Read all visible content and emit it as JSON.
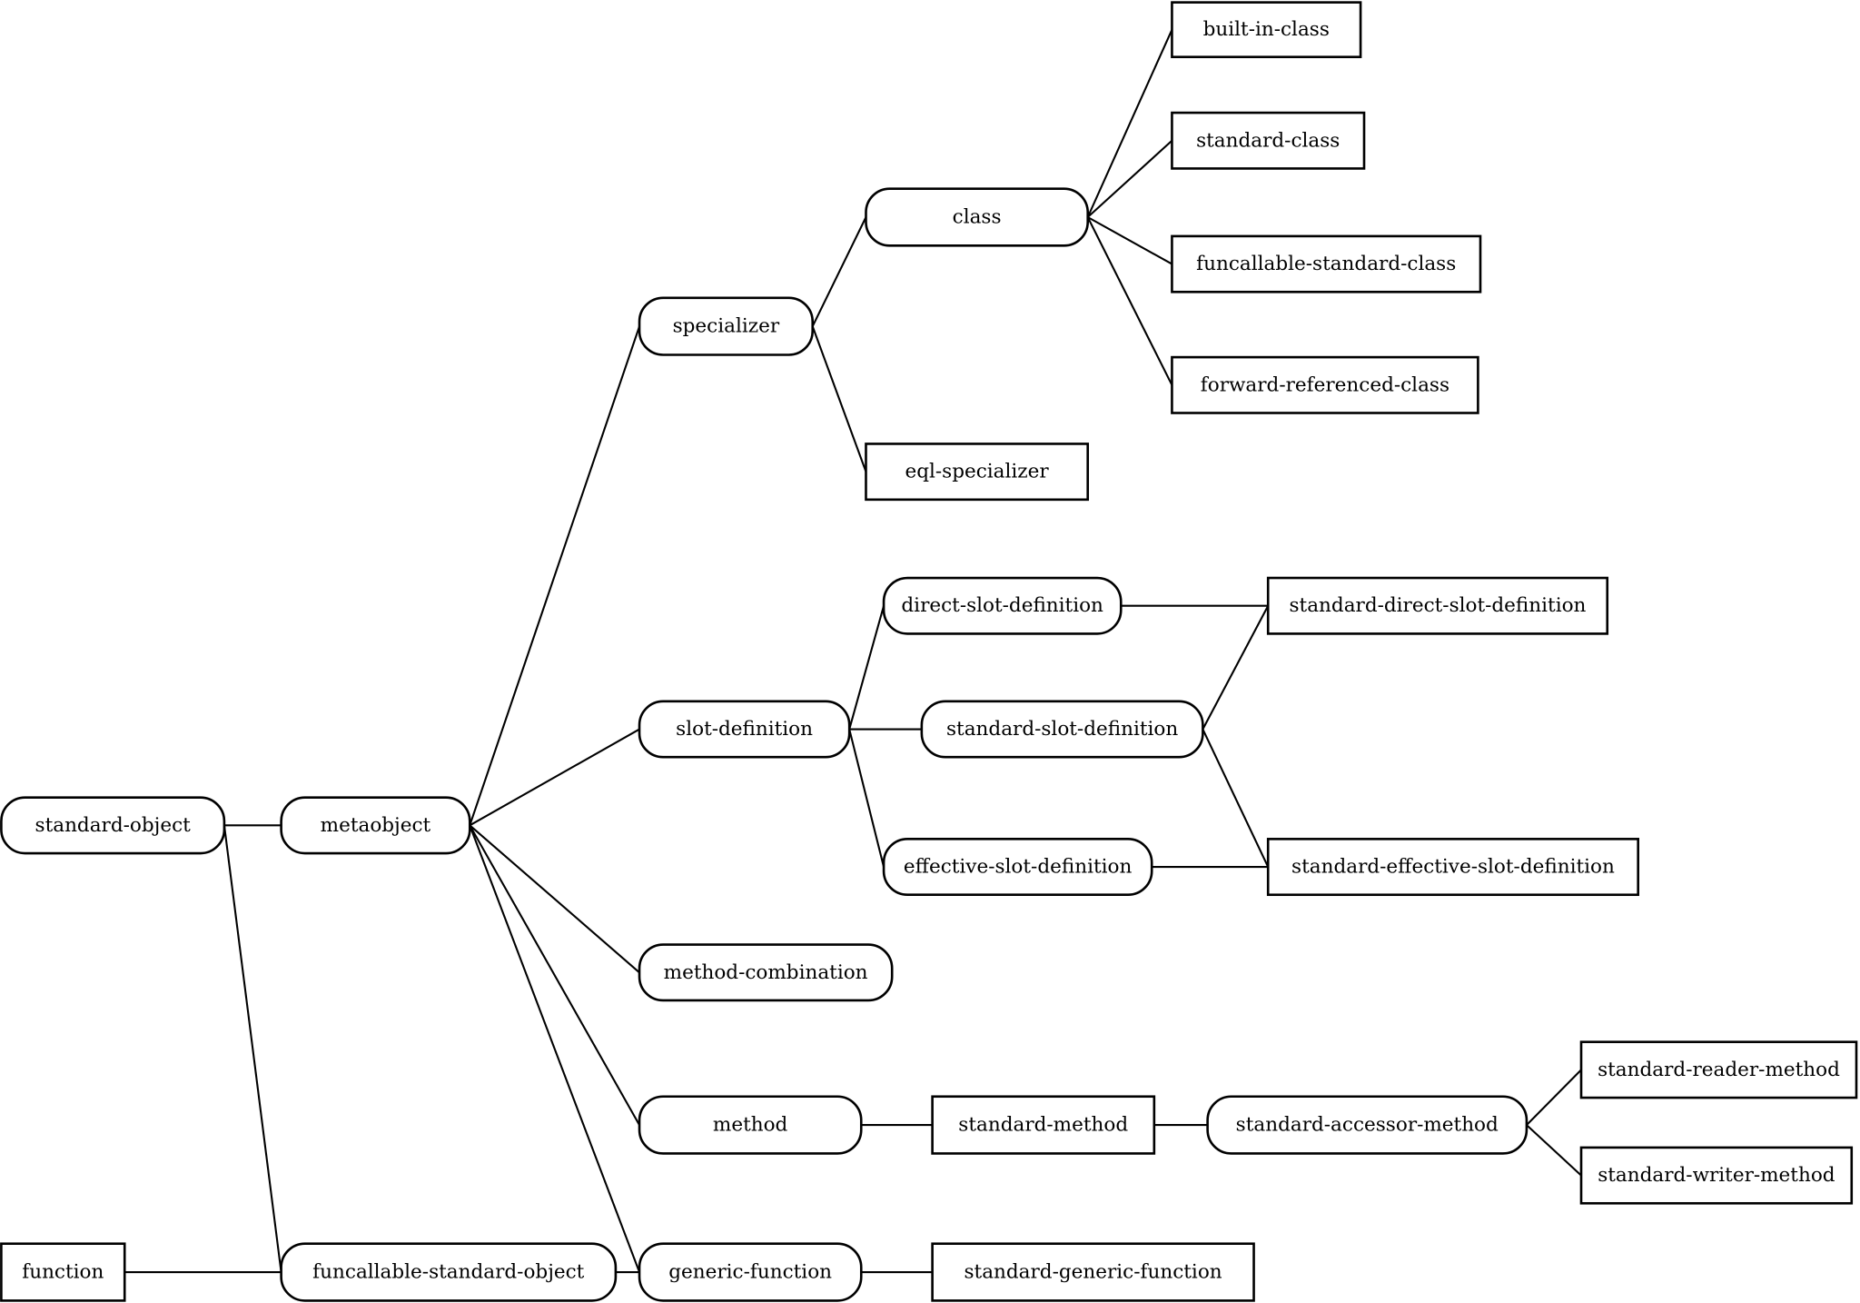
{
  "diagram": {
    "nodes": [
      {
        "id": "built-in-class",
        "label": "built-in-class",
        "shape": "rect"
      },
      {
        "id": "standard-class",
        "label": "standard-class",
        "shape": "rect"
      },
      {
        "id": "funcallable-standard-class",
        "label": "funcallable-standard-class",
        "shape": "rect"
      },
      {
        "id": "forward-referenced-class",
        "label": "forward-referenced-class",
        "shape": "rect"
      },
      {
        "id": "class",
        "label": "class",
        "shape": "rounded"
      },
      {
        "id": "specializer",
        "label": "specializer",
        "shape": "rounded"
      },
      {
        "id": "eql-specializer",
        "label": "eql-specializer",
        "shape": "rect"
      },
      {
        "id": "direct-slot-definition",
        "label": "direct-slot-definition",
        "shape": "rounded"
      },
      {
        "id": "standard-direct-slot-definition",
        "label": "standard-direct-slot-definition",
        "shape": "rect"
      },
      {
        "id": "slot-definition",
        "label": "slot-definition",
        "shape": "rounded"
      },
      {
        "id": "standard-slot-definition",
        "label": "standard-slot-definition",
        "shape": "rounded"
      },
      {
        "id": "effective-slot-definition",
        "label": "effective-slot-definition",
        "shape": "rounded"
      },
      {
        "id": "standard-effective-slot-definition",
        "label": "standard-effective-slot-definition",
        "shape": "rect"
      },
      {
        "id": "standard-object",
        "label": "standard-object",
        "shape": "rounded"
      },
      {
        "id": "metaobject",
        "label": "metaobject",
        "shape": "rounded"
      },
      {
        "id": "method-combination",
        "label": "method-combination",
        "shape": "rounded"
      },
      {
        "id": "method",
        "label": "method",
        "shape": "rounded"
      },
      {
        "id": "standard-method",
        "label": "standard-method",
        "shape": "rect"
      },
      {
        "id": "standard-accessor-method",
        "label": "standard-accessor-method",
        "shape": "rounded"
      },
      {
        "id": "standard-reader-method",
        "label": "standard-reader-method",
        "shape": "rect"
      },
      {
        "id": "standard-writer-method",
        "label": "standard-writer-method",
        "shape": "rect"
      },
      {
        "id": "function",
        "label": "function",
        "shape": "rect"
      },
      {
        "id": "funcallable-standard-object",
        "label": "funcallable-standard-object",
        "shape": "rounded"
      },
      {
        "id": "generic-function",
        "label": "generic-function",
        "shape": "rounded"
      },
      {
        "id": "standard-generic-function",
        "label": "standard-generic-function",
        "shape": "rect"
      }
    ],
    "edges": [
      [
        "standard-object",
        "metaobject"
      ],
      [
        "standard-object",
        "funcallable-standard-object"
      ],
      [
        "function",
        "funcallable-standard-object"
      ],
      [
        "funcallable-standard-object",
        "generic-function"
      ],
      [
        "metaobject",
        "specializer"
      ],
      [
        "metaobject",
        "slot-definition"
      ],
      [
        "metaobject",
        "method-combination"
      ],
      [
        "metaobject",
        "method"
      ],
      [
        "metaobject",
        "generic-function"
      ],
      [
        "specializer",
        "class"
      ],
      [
        "specializer",
        "eql-specializer"
      ],
      [
        "class",
        "built-in-class"
      ],
      [
        "class",
        "standard-class"
      ],
      [
        "class",
        "funcallable-standard-class"
      ],
      [
        "class",
        "forward-referenced-class"
      ],
      [
        "slot-definition",
        "direct-slot-definition"
      ],
      [
        "slot-definition",
        "standard-slot-definition"
      ],
      [
        "slot-definition",
        "effective-slot-definition"
      ],
      [
        "direct-slot-definition",
        "standard-direct-slot-definition"
      ],
      [
        "standard-slot-definition",
        "standard-direct-slot-definition"
      ],
      [
        "standard-slot-definition",
        "standard-effective-slot-definition"
      ],
      [
        "effective-slot-definition",
        "standard-effective-slot-definition"
      ],
      [
        "method",
        "standard-method"
      ],
      [
        "standard-method",
        "standard-accessor-method"
      ],
      [
        "standard-accessor-method",
        "standard-reader-method"
      ],
      [
        "standard-accessor-method",
        "standard-writer-method"
      ],
      [
        "generic-function",
        "standard-generic-function"
      ]
    ]
  }
}
